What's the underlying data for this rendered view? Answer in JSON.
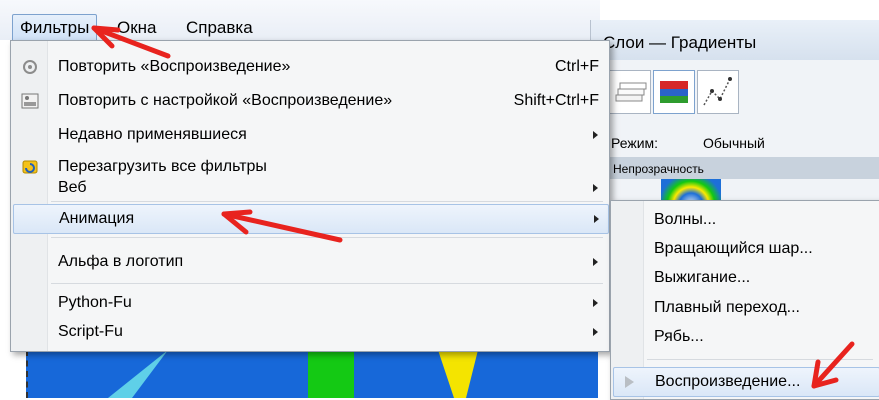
{
  "menubar": {
    "filters": "Фильтры",
    "windows": "Окна",
    "help": "Справка"
  },
  "layers_panel": {
    "title": "Слои — Градиенты",
    "mode_label": "Режим:",
    "mode_value": "Обычный",
    "opacity_label": "Непрозрачность"
  },
  "filters_menu": {
    "repeat": {
      "label": "Повторить «Воспроизведение»",
      "shortcut": "Ctrl+F"
    },
    "reshow": {
      "label": "Повторить с настройкой «Воспроизведение»",
      "shortcut": "Shift+Ctrl+F"
    },
    "recent": {
      "label": "Недавно применявшиеся"
    },
    "reset": {
      "label": "Перезагрузить все фильтры"
    },
    "web": {
      "label": "Веб"
    },
    "animation": {
      "label": "Анимация"
    },
    "alpha_to_logo": {
      "label": "Альфа в логотип"
    },
    "python_fu": {
      "label": "Python-Fu"
    },
    "script_fu": {
      "label": "Script-Fu"
    }
  },
  "animation_submenu": {
    "waves": "Волны...",
    "spinning_globe": "Вращающийся шар...",
    "burn_in": "Выжигание...",
    "blend": "Плавный переход...",
    "rippling": "Рябь...",
    "playback": "Воспроизведение..."
  },
  "annotation_color": "#e8231e"
}
